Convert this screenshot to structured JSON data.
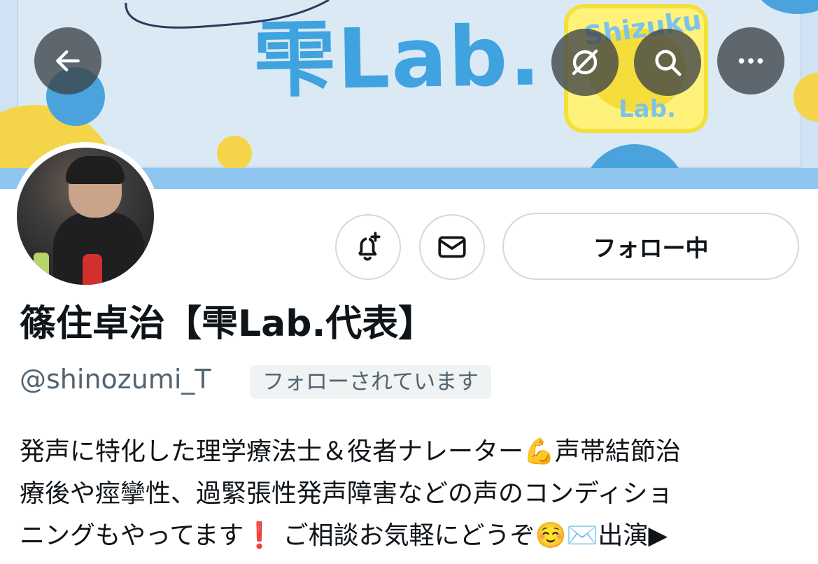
{
  "banner": {
    "title": "雫Lab.",
    "logo_top_text": "Shizuku",
    "logo_bottom_text": "Lab."
  },
  "toolbar": {
    "back_icon": "arrow-left-icon",
    "link_icon": "link-off-icon",
    "search_icon": "search-icon",
    "more_icon": "more-horizontal-icon"
  },
  "actions": {
    "notify_icon": "bell-plus-icon",
    "message_icon": "envelope-icon",
    "follow_label": "フォロー中"
  },
  "profile": {
    "display_name": "篠住卓治【雫Lab.代表】",
    "handle": "@shinozumi_T",
    "follows_you": "フォローされています",
    "bio_lines": [
      "発声に特化した理学療法士＆役者ナレーター💪声帯結節治",
      "療後や痙攣性、過緊張性発声障害などの声のコンディショ",
      "ニングもやってます❗ ご相談お気軽にどうぞ☺️✉️出演▶"
    ]
  },
  "colors": {
    "accent_blue": "#3ea3df",
    "banner_yellow": "#f5dd3c",
    "secondary_text": "#536471",
    "border": "#cfd9de"
  }
}
